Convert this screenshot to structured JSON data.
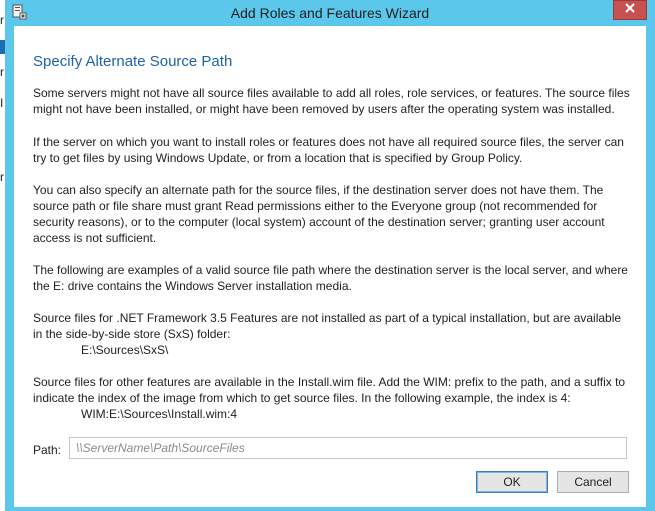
{
  "window": {
    "title": "Add Roles and Features Wizard"
  },
  "background": {
    "chars": [
      "r",
      "r",
      "I",
      "r"
    ]
  },
  "page": {
    "heading": "Specify Alternate Source Path",
    "paragraphs": [
      "Some servers might not have all source files available to add all roles, role services, or features. The source files might not have been installed, or might have been removed by users after the operating system was installed.",
      "If the server on which you want to install roles or features does not have all required source files, the server can try to get files by using Windows Update, or from a location that is specified by Group Policy.",
      "You can also specify an alternate path for the source files, if the destination server does not have them. The source path or file share must grant Read permissions either to the Everyone group (not recommended for security reasons), or to the computer (local system) account of the destination server; granting user account access is not sufficient.",
      "The following are examples of a valid source file path where the destination server is the local server, and where the E: drive contains the Windows Server installation media.",
      "Source files for .NET Framework 3.5 Features are not installed as part of a typical installation, but are available in the side-by-side store (SxS) folder:",
      "Source files for other features are available in the Install.wim file. Add the WIM: prefix to the path, and a suffix to indicate the index of the image from which to get source files. In the following example, the index is 4:"
    ],
    "examples": [
      "E:\\Sources\\SxS\\",
      "WIM:E:\\Sources\\Install.wim:4"
    ]
  },
  "path_field": {
    "label": "Path:",
    "value": "",
    "placeholder": "\\\\ServerName\\Path\\SourceFiles"
  },
  "buttons": {
    "ok": "OK",
    "cancel": "Cancel"
  },
  "icons": {
    "app": "server-manager-icon",
    "close": "close-icon"
  },
  "colors": {
    "frame": "#5bc7ea",
    "heading": "#1e63a8",
    "close_button": "#c75050"
  }
}
